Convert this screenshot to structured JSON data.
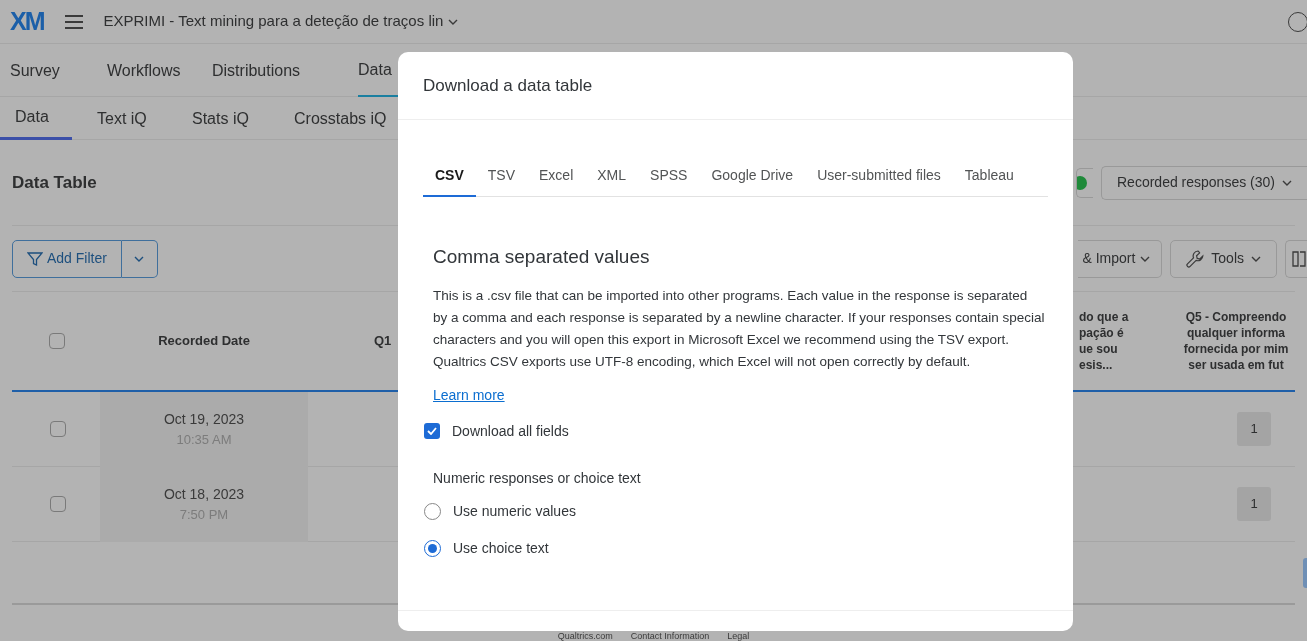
{
  "header": {
    "logo": "XM",
    "title": "EXPRIMI - Text mining para a deteção de traços lin"
  },
  "nav_tabs": [
    {
      "label": "Survey",
      "selected": false
    },
    {
      "label": "Workflows",
      "selected": false
    },
    {
      "label": "Distributions",
      "selected": false
    },
    {
      "label": "Data",
      "selected": true
    }
  ],
  "sub_tabs": [
    {
      "label": "Data",
      "selected": true
    },
    {
      "label": "Text iQ",
      "selected": false
    },
    {
      "label": "Stats iQ",
      "selected": false
    },
    {
      "label": "Crosstabs iQ",
      "selected": false
    }
  ],
  "page_title": "Data Table",
  "responses_dropdown": "Recorded responses (30)",
  "toolbar": {
    "filter_button": "Add Filter",
    "import_button": "& Import",
    "tools_button": "Tools"
  },
  "table": {
    "select_all": {
      "checked": false
    },
    "columns": [
      {
        "lines": [
          "Recorded Date"
        ]
      },
      {
        "lines": [
          "Q1"
        ]
      },
      {
        "lines": [
          "do que a",
          "pação é",
          "ue sou",
          "esis..."
        ]
      },
      {
        "lines": [
          "Q5 - Compreendo",
          "qualquer informa",
          "fornecida por mim",
          "ser usada em fut"
        ]
      }
    ],
    "rows": [
      {
        "checked": false,
        "date": "Oct 19, 2023",
        "time": "10:35 AM",
        "q5": "1"
      },
      {
        "checked": false,
        "date": "Oct 18, 2023",
        "time": "7:50 PM",
        "q5": "1"
      }
    ]
  },
  "footer_links": [
    "Qualtrics.com",
    "Contact Information",
    "Legal"
  ],
  "dialog": {
    "title": "Download a data table",
    "tabs": [
      {
        "label": "CSV",
        "selected": true
      },
      {
        "label": "TSV",
        "selected": false
      },
      {
        "label": "Excel",
        "selected": false
      },
      {
        "label": "XML",
        "selected": false
      },
      {
        "label": "SPSS",
        "selected": false
      },
      {
        "label": "Google Drive",
        "selected": false
      },
      {
        "label": "User-submitted files",
        "selected": false
      },
      {
        "label": "Tableau",
        "selected": false
      }
    ],
    "heading": "Comma separated values",
    "description": "This is a .csv file that can be imported into other programs. Each value in the response is separated by a comma and each response is separated by a newline character. If your responses contain special characters and you will open this export in Microsoft Excel we recommend using the TSV export. Qualtrics CSV exports use UTF-8 encoding, which Excel will not open correctly by default.",
    "learn_more": "Learn more",
    "download_all_fields": {
      "label": "Download all fields",
      "checked": true
    },
    "numeric_group": {
      "label": "Numeric responses or choice text",
      "options": [
        {
          "label": "Use numeric values",
          "selected": false
        },
        {
          "label": "Use choice text",
          "selected": true
        }
      ]
    }
  }
}
